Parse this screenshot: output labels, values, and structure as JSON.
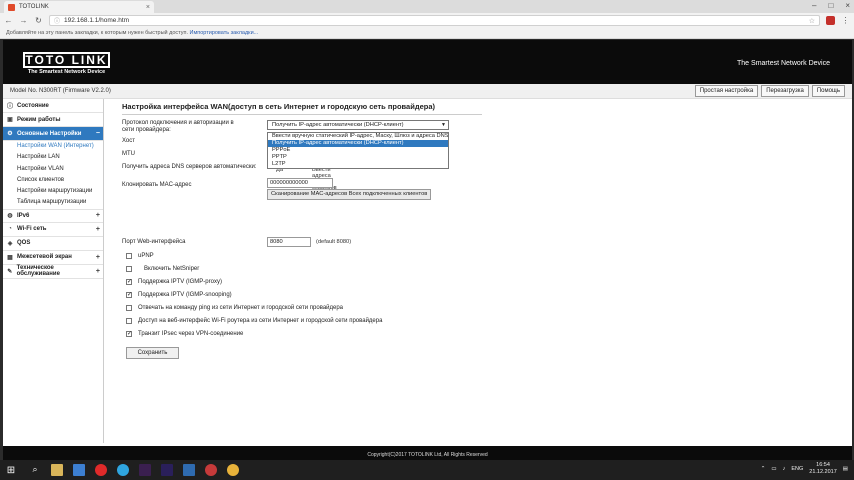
{
  "browser": {
    "tab_title": "TOTOLINK",
    "url": "192.168.1.1/home.htm",
    "bookmarks_text": "Добавляйте на эту панель закладки, к которым нужен быстрый доступ.",
    "bookmarks_link": "Импортировать закладки..."
  },
  "header": {
    "logo": "TOTO LINK",
    "logo_tagline": "The Smartest Network Device",
    "tagline_right": "The Smartest Network Device"
  },
  "model_bar": {
    "model": "Model No. N300RT (Firmware V2.2.0)",
    "buttons": [
      "Простая настройка",
      "Перезагрузка",
      "Помощь"
    ]
  },
  "sidebar": {
    "items": [
      {
        "label": "Состояние",
        "icon": "info-icon"
      },
      {
        "label": "Режим работы",
        "icon": "mode-icon"
      },
      {
        "label": "Основные Настройки",
        "icon": "settings-icon",
        "expander": "−",
        "active": true
      },
      {
        "label": "IPv6",
        "icon": "ipv6-icon",
        "expander": "+"
      },
      {
        "label": "Wi-Fi сеть",
        "icon": "wifi-icon",
        "expander": "+"
      },
      {
        "label": "QOS",
        "icon": "qos-icon"
      },
      {
        "label": "Межсетевой экран",
        "icon": "firewall-icon",
        "expander": "+"
      },
      {
        "label": "Техническое обслуживание",
        "icon": "tools-icon",
        "expander": "+"
      }
    ],
    "sub_items": [
      "Настройки WAN (Интернет)",
      "Настройки LAN",
      "Настройки VLAN",
      "Список клиентов",
      "Настройки маршрутизации",
      "Таблица маршрутизации"
    ]
  },
  "content": {
    "title": "Настройка интерфейса WAN(доступ в сеть Интернет и городскую сеть провайдера)",
    "protocol_label": "Протокол подключения и авторизации в сети провайдера:",
    "protocol_value": "Получить IP-адрес автоматически (DHCP-клиент)",
    "protocol_options": [
      "Ввести вручную статический IP-адрес, Маску, Шлюз и адреса DNS",
      "Получить IP-адрес автоматически (DHCP-клиент)",
      "PPPoE",
      "PPTP",
      "L2TP"
    ],
    "host_label": "Хост",
    "mtu_label": "MTU",
    "dns_label": "Получить адреса DNS серверов автоматически:",
    "dns_manual_text": "Да",
    "dns_manual_text2": "Ввести адреса DNS серверов вручную",
    "mac_label": "Клонировать MAC-адрес",
    "mac_value": "000000000000",
    "mac_scan_button": "Сканирование MAC-адресов Всех подключенных клиентов",
    "port_label": "Порт Web-интерфейса",
    "port_value": "8080",
    "port_default": "(default 8080)",
    "checkboxes": [
      {
        "label": "uPNP",
        "checked": false
      },
      {
        "label": "Включить NetSniper",
        "checked": false
      },
      {
        "label": "Поддержка IPTV (IGMP-proxy)",
        "checked": true
      },
      {
        "label": "Поддержка IPTV (IGMP-snooping)",
        "checked": true
      },
      {
        "label": "Отвечать на команду ping из сети Интернет и городской сети провайдера",
        "checked": false
      },
      {
        "label": "Доступ на веб-интерфейс Wi-Fi роутера из сети Интернет и городской сети провайдера",
        "checked": false
      },
      {
        "label": "Транзит IPsec через VPN-соединение",
        "checked": true
      }
    ],
    "save_button": "Сохранить"
  },
  "footer": {
    "copyright": "Copyright(C)2017 TOTOLINK Ltd, All Rights Reserved"
  },
  "taskbar": {
    "lang": "ENG",
    "time": "16:54",
    "date": "21.12.2017"
  }
}
